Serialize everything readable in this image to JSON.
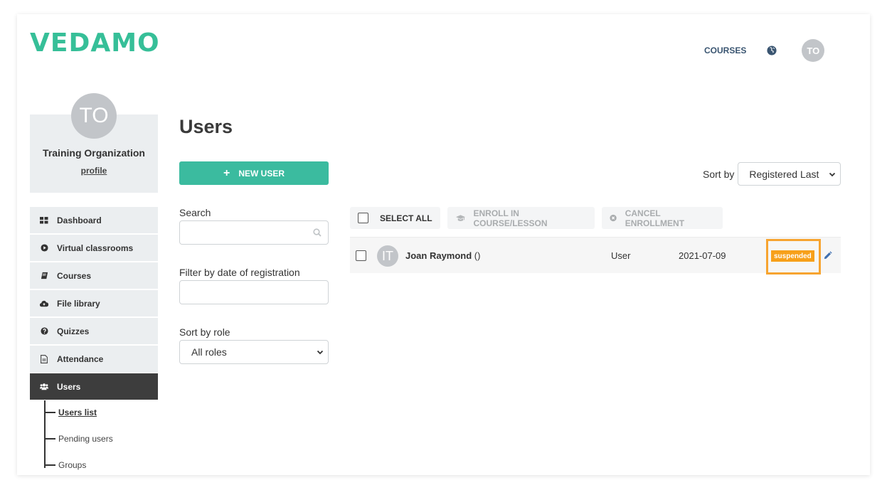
{
  "header": {
    "logo": "VEDAMO",
    "nav_courses": "COURSES",
    "globe_icon": "globe-icon",
    "user_initials": "TO"
  },
  "sidebar": {
    "profile": {
      "initials": "TO",
      "org_name": "Training Organization",
      "profile_link": "profile"
    },
    "items": [
      {
        "label": "Dashboard",
        "icon": "dashboard-icon"
      },
      {
        "label": "Virtual classrooms",
        "icon": "play-circle-icon"
      },
      {
        "label": "Courses",
        "icon": "book-icon"
      },
      {
        "label": "File library",
        "icon": "cloud-upload-icon"
      },
      {
        "label": "Quizzes",
        "icon": "question-circle-icon"
      },
      {
        "label": "Attendance",
        "icon": "document-icon"
      },
      {
        "label": "Users",
        "icon": "users-icon",
        "active": true
      }
    ],
    "subitems": [
      {
        "label": "Users list",
        "current": true
      },
      {
        "label": "Pending users"
      },
      {
        "label": "Groups"
      }
    ]
  },
  "main": {
    "title": "Users",
    "new_user_label": "NEW USER",
    "filters": {
      "search_label": "Search",
      "search_value": "",
      "date_label": "Filter by date of registration",
      "date_value": "",
      "role_label": "Sort by role",
      "role_selected": "All roles"
    },
    "sort": {
      "label": "Sort by",
      "selected": "Registered Last"
    },
    "toolbar": {
      "select_all": "SELECT ALL",
      "enroll": "ENROLL IN COURSE/LESSON",
      "cancel": "CANCEL ENROLLMENT"
    },
    "users": [
      {
        "initials": "IT",
        "name": "Joan Raymond",
        "suffix": " ()",
        "role": "User",
        "registered": "2021-07-09",
        "status": "suspended",
        "checked": false
      }
    ]
  },
  "colors": {
    "brand": "#36bf98",
    "primary_button": "#3bbb9f",
    "active_menu": "#3d3d3d",
    "status_suspended": "#f7a01a",
    "highlight_frame": "#f7a430",
    "nav_text": "#3a5571"
  }
}
